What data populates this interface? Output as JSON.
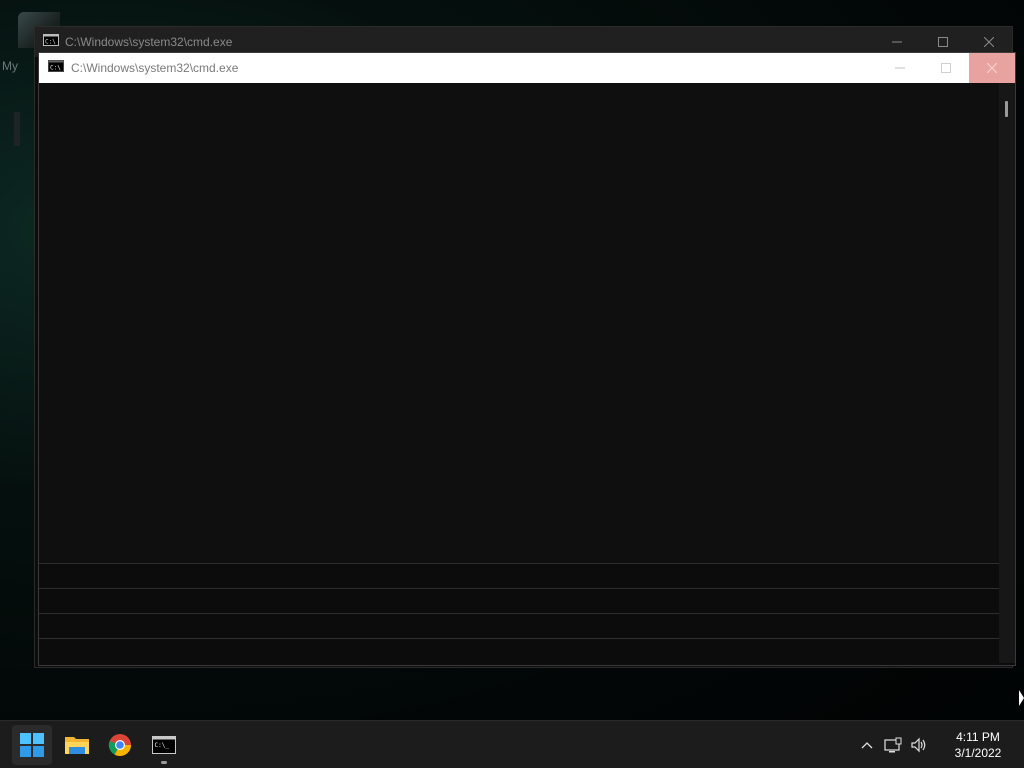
{
  "desktop": {
    "icon_label": "My"
  },
  "back_window": {
    "title": "C:\\Windows\\system32\\cmd.exe",
    "controls": {
      "minimize": "—",
      "maximize": "☐",
      "close": "✕"
    }
  },
  "front_window": {
    "title": "C:\\Windows\\system32\\cmd.exe",
    "controls": {
      "minimize": "—",
      "maximize": "☐",
      "close": "✕"
    },
    "console_text": ""
  },
  "taskbar": {
    "apps": [
      {
        "name": "Start",
        "icon": "windows-logo-icon"
      },
      {
        "name": "File Explorer",
        "icon": "folder-icon"
      },
      {
        "name": "Google Chrome",
        "icon": "chrome-icon"
      },
      {
        "name": "Command Prompt",
        "icon": "cmd-icon",
        "running": true
      }
    ],
    "tray": {
      "chevron": "^",
      "icons": [
        "network-icon",
        "volume-icon"
      ]
    },
    "clock": {
      "time": "4:11 PM",
      "date": "3/1/2022"
    }
  },
  "colors": {
    "console_bg": "#0c0c0c",
    "taskbar_bg": "#1c1c1c",
    "close_hover": "#e8a3a0",
    "start_blue": "#3aa0f0"
  }
}
